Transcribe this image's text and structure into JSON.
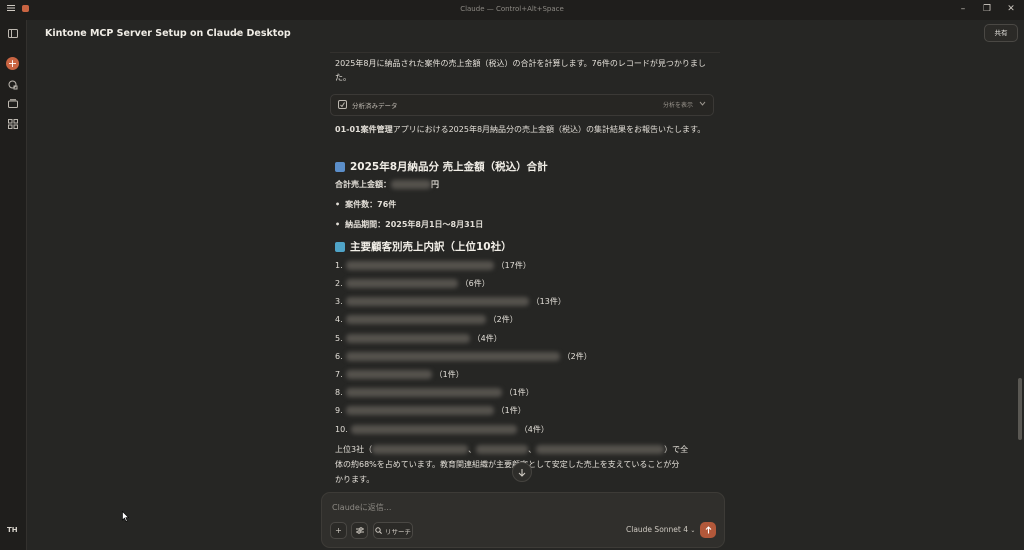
{
  "window": {
    "title": "Claude — Control+Alt+Space"
  },
  "sidebar": {
    "user_initials": "TH"
  },
  "header": {
    "title": "Kintone MCP Server Setup on Claude Desktop",
    "share_label": "共有"
  },
  "message": {
    "intro": "2025年8月に納品された案件の売上金額（税込）の合計を計算します。76件のレコードが見つかりました。",
    "analysis": {
      "label": "分析済みデータ",
      "toggle": "分析を表示"
    },
    "summary_bold": "01-01案件管理",
    "summary_rest": "アプリにおける2025年8月納品分の売上金額（税込）の集計結果をお報告いたします。",
    "heading1": "2025年8月納品分 売上金額（税込）合計",
    "total_label": "合計売上金額：",
    "total_suffix": "円",
    "bullets": [
      "案件数：76件",
      "納品期間：2025年8月1日〜8月31日"
    ],
    "heading2": "主要顧客別売上内訳（上位10社）",
    "customers": [
      {
        "num": "1.",
        "count": "（17件）"
      },
      {
        "num": "2.",
        "count": "（6件）"
      },
      {
        "num": "3.",
        "count": "（13件）"
      },
      {
        "num": "4.",
        "count": "（2件）"
      },
      {
        "num": "5.",
        "count": "（4件）"
      },
      {
        "num": "6.",
        "count": "（2件）"
      },
      {
        "num": "7.",
        "count": "（1件）"
      },
      {
        "num": "8.",
        "count": "（1件）"
      },
      {
        "num": "9.",
        "count": "（1件）"
      },
      {
        "num": "10.",
        "count": "（4件）"
      }
    ],
    "closing_prefix": "上位3社（",
    "closing_sep": "、",
    "closing_line1_end": "）で全",
    "closing_line2": "体の約68%を占めています。教育関連組織が主要顧客として安定した売上を支えていることが分",
    "closing_line3": "かります。"
  },
  "composer": {
    "placeholder": "Claudeに返信...",
    "research_label": "リサーチ",
    "model": "Claude Sonnet 4"
  },
  "colors": {
    "accent": "#c96442",
    "background": "#262624",
    "sidebar": "#1f1e1c"
  }
}
